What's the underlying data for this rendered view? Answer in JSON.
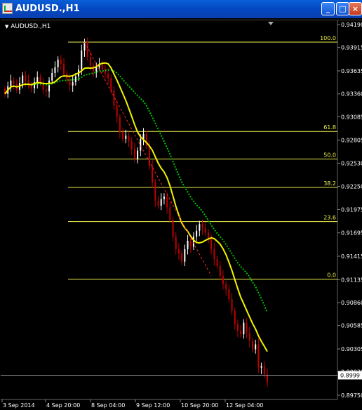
{
  "window": {
    "title": "AUDUSD.,H1",
    "minimize_symbol": "_",
    "maximize_symbol": "□",
    "close_symbol": "×"
  },
  "chart": {
    "symbol_label": "AUDUSD.,H1",
    "current_price": "0.8999",
    "colors": {
      "background": "#000000",
      "bull": "#ffffff",
      "bear": "#c00000",
      "fib": "#f0f050",
      "ma_fast": "#f2f200",
      "ma_slow": "#00c000",
      "trend": "#ff2a2a"
    }
  },
  "chart_data": {
    "type": "candlestick",
    "price_axis": [
      "0.94190",
      "0.93915",
      "0.93635",
      "0.93360",
      "0.93085",
      "0.92805",
      "0.92530",
      "0.92250",
      "0.91975",
      "0.91695",
      "0.91415",
      "0.91135",
      "0.90860",
      "0.90585",
      "0.90305",
      "0.90030",
      "0.89750"
    ],
    "time_axis": [
      "3 Sep 2014",
      "4 Sep 20:00",
      "8 Sep 04:00",
      "9 Sep 12:00",
      "10 Sep 20:00",
      "12 Sep 04:00"
    ],
    "fibonacci_levels": [
      {
        "label": "100.0",
        "price": 0.9398
      },
      {
        "label": "61.8",
        "price": 0.9291
      },
      {
        "label": "50.0",
        "price": 0.9258
      },
      {
        "label": "38.2",
        "price": 0.9224
      },
      {
        "label": "23.6",
        "price": 0.9183
      },
      {
        "label": "0.0",
        "price": 0.9114
      }
    ],
    "price_range": [
      0.8975,
      0.9419
    ],
    "candles_close": [
      0.9336,
      0.9345,
      0.9352,
      0.9348,
      0.9341,
      0.9349,
      0.9358,
      0.9352,
      0.9346,
      0.9343,
      0.935,
      0.9356,
      0.9349,
      0.9341,
      0.9339,
      0.9352,
      0.9361,
      0.9368,
      0.9377,
      0.9372,
      0.936,
      0.9354,
      0.9346,
      0.935,
      0.9357,
      0.9365,
      0.9388,
      0.9398,
      0.938,
      0.937,
      0.9363,
      0.9368,
      0.9372,
      0.9366,
      0.936,
      0.9355,
      0.934,
      0.9322,
      0.9308,
      0.929,
      0.9282,
      0.9286,
      0.9279,
      0.927,
      0.9258,
      0.9268,
      0.9282,
      0.9288,
      0.9274,
      0.925,
      0.923,
      0.9208,
      0.9202,
      0.921,
      0.9213,
      0.92,
      0.9185,
      0.9165,
      0.915,
      0.9145,
      0.9135,
      0.915,
      0.916,
      0.9153,
      0.9165,
      0.9172,
      0.918,
      0.9175,
      0.917,
      0.9162,
      0.915,
      0.9138,
      0.913,
      0.9118,
      0.9108,
      0.9102,
      0.909,
      0.9076,
      0.906,
      0.9052,
      0.9048,
      0.9062,
      0.905,
      0.904,
      0.903,
      0.9036,
      0.9008,
      0.901,
      0.9,
      0.899
    ]
  }
}
